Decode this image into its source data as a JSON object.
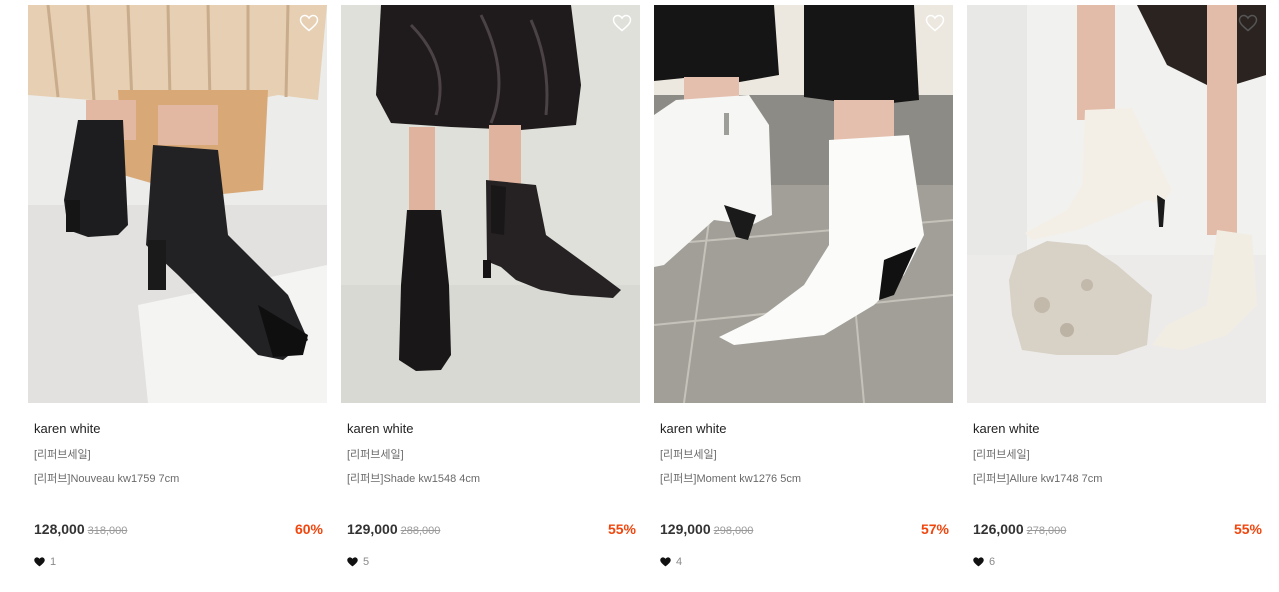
{
  "products": [
    {
      "brand": "karen white",
      "tag": "[리퍼브세일]",
      "name": "[리퍼브]Nouveau kw1759 7cm",
      "price": "128,000",
      "original_price": "318,000",
      "discount": "60%",
      "likes": "1",
      "wishlist_icon": "heart-outline-icon"
    },
    {
      "brand": "karen white",
      "tag": "[리퍼브세일]",
      "name": "[리퍼브]Shade kw1548 4cm",
      "price": "129,000",
      "original_price": "288,000",
      "discount": "55%",
      "likes": "5",
      "wishlist_icon": "heart-outline-icon"
    },
    {
      "brand": "karen white",
      "tag": "[리퍼브세일]",
      "name": "[리퍼브]Moment kw1276 5cm",
      "price": "129,000",
      "original_price": "298,000",
      "discount": "57%",
      "likes": "4",
      "wishlist_icon": "heart-outline-icon"
    },
    {
      "brand": "karen white",
      "tag": "[리퍼브세일]",
      "name": "[리퍼브]Allure kw1748 7cm",
      "price": "126,000",
      "original_price": "278,000",
      "discount": "55%",
      "likes": "6",
      "wishlist_icon": "heart-outline-icon"
    }
  ],
  "colors": {
    "discount": "#f0460e",
    "price": "#333333",
    "muted": "#6a6a6a"
  }
}
